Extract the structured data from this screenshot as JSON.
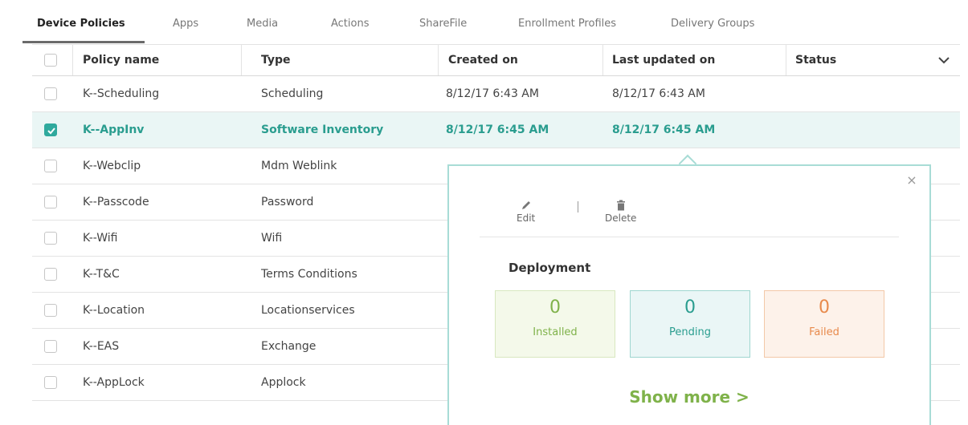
{
  "tabs": [
    {
      "label": "Device Policies",
      "active": true
    },
    {
      "label": "Apps"
    },
    {
      "label": "Media"
    },
    {
      "label": "Actions"
    },
    {
      "label": "ShareFile"
    },
    {
      "label": "Enrollment Profiles"
    },
    {
      "label": "Delivery Groups"
    }
  ],
  "table": {
    "headers": {
      "policy_name": "Policy name",
      "type": "Type",
      "created_on": "Created on",
      "last_updated_on": "Last updated on",
      "status": "Status"
    },
    "rows": [
      {
        "name": "K--Scheduling",
        "type": "Scheduling",
        "created": "8/12/17 6:43 AM",
        "updated": "8/12/17 6:43 AM",
        "checked": false
      },
      {
        "name": "K--AppInv",
        "type": "Software Inventory",
        "created": "8/12/17 6:45 AM",
        "updated": "8/12/17 6:45 AM",
        "checked": true
      },
      {
        "name": "K--Webclip",
        "type": "Mdm Weblink",
        "checked": false
      },
      {
        "name": "K--Passcode",
        "type": "Password",
        "checked": false
      },
      {
        "name": "K--Wifi",
        "type": "Wifi",
        "checked": false
      },
      {
        "name": "K--T&C",
        "type": "Terms Conditions",
        "checked": false
      },
      {
        "name": "K--Location",
        "type": "Locationservices",
        "checked": false
      },
      {
        "name": "K--EAS",
        "type": "Exchange",
        "checked": false
      },
      {
        "name": "K--AppLock",
        "type": "Applock",
        "checked": false
      }
    ]
  },
  "popover": {
    "close_symbol": "×",
    "edit_label": "Edit",
    "delete_label": "Delete",
    "deployment_title": "Deployment",
    "installed": {
      "value": "0",
      "label": "Installed",
      "color": "#7fb24a"
    },
    "pending": {
      "value": "0",
      "label": "Pending",
      "color": "#2a9d8f"
    },
    "failed": {
      "value": "0",
      "label": "Failed",
      "color": "#e88a4c"
    },
    "show_more": "Show more >"
  },
  "icons": {
    "header_menu": "chevron-down-icon",
    "edit": "pencil-icon",
    "delete": "trash-icon",
    "checked": "check-icon"
  }
}
